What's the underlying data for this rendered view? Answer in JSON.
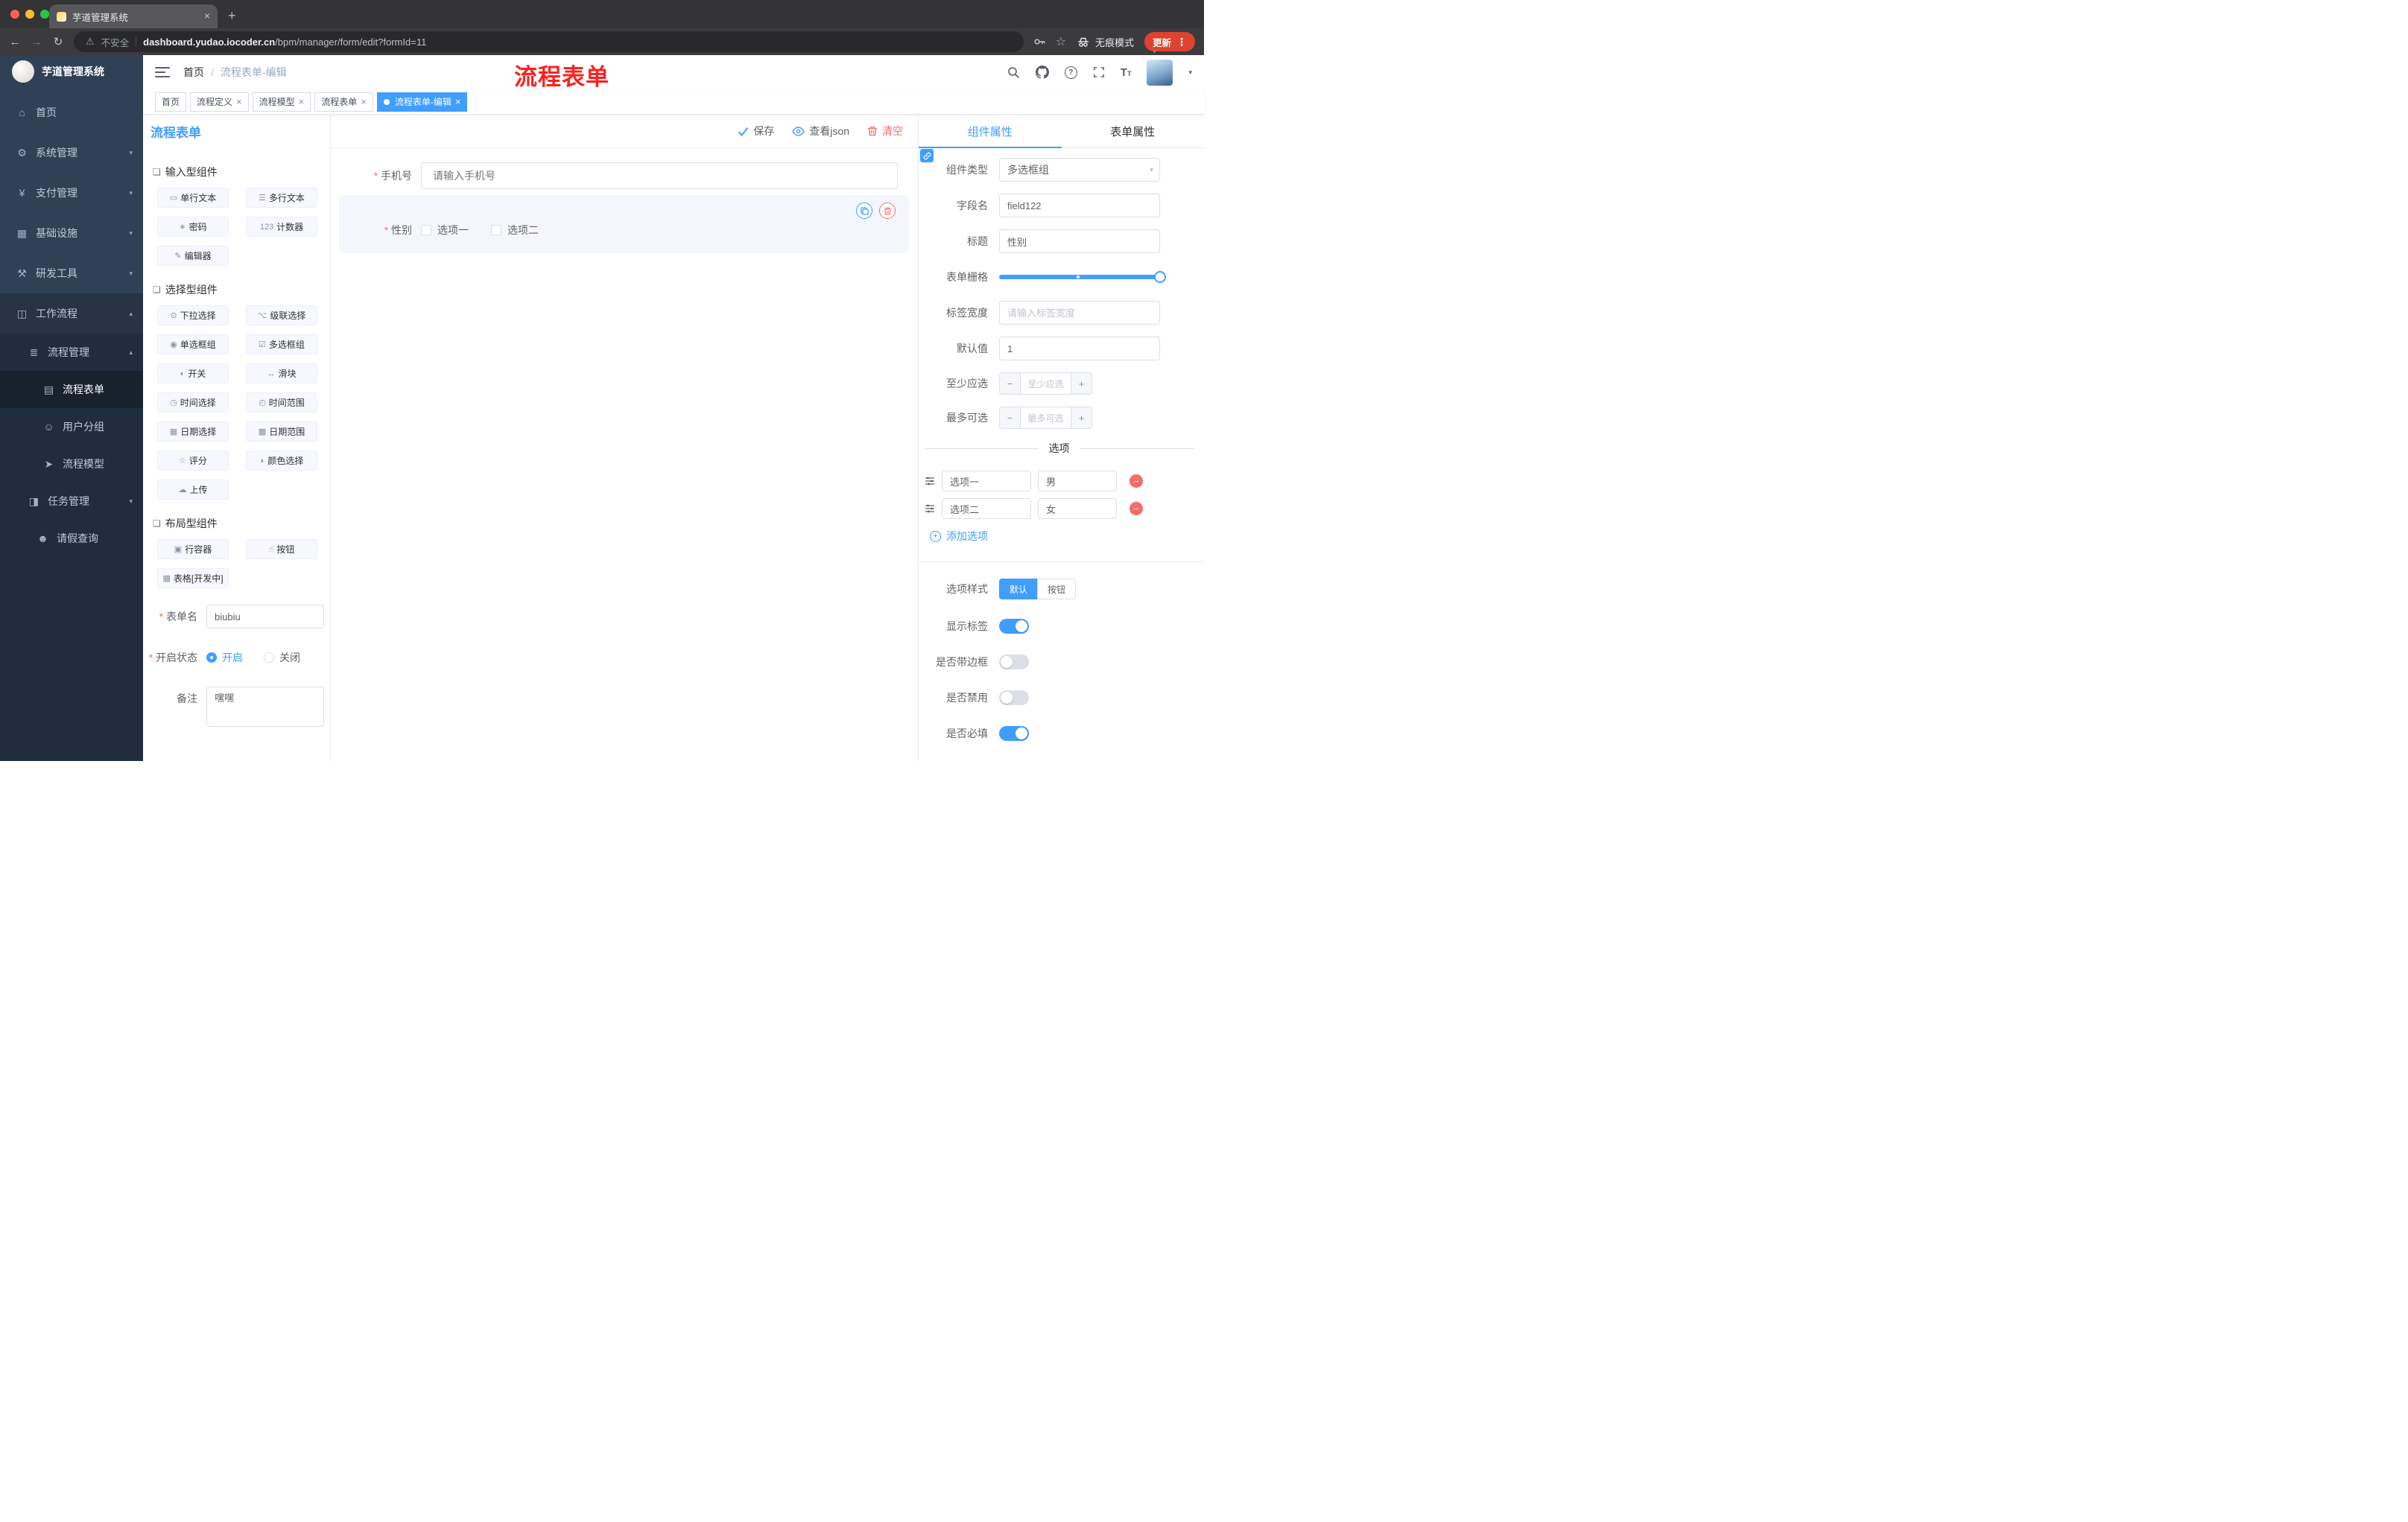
{
  "browser": {
    "tab_title": "芋道管理系统",
    "security_label": "不安全",
    "url_domain": "dashboard.yudao.iocoder.cn",
    "url_path": "/bpm/manager/form/edit?formId=11",
    "incognito_label": "无痕模式",
    "update_label": "更新"
  },
  "sidebar": {
    "logo_title": "芋道管理系统",
    "items": [
      {
        "label": "首页",
        "icon": "⌂"
      },
      {
        "label": "系统管理",
        "icon": "⚙"
      },
      {
        "label": "支付管理",
        "icon": "¥"
      },
      {
        "label": "基础设施",
        "icon": "▦"
      },
      {
        "label": "研发工具",
        "icon": "⚒"
      },
      {
        "label": "工作流程",
        "icon": "◫"
      },
      {
        "label": "流程管理",
        "icon": "≣"
      },
      {
        "label": "流程表单",
        "icon": "▤"
      },
      {
        "label": "用户分组",
        "icon": "☺"
      },
      {
        "label": "流程模型",
        "icon": "➤"
      },
      {
        "label": "任务管理",
        "icon": "◨"
      },
      {
        "label": "请假查询",
        "icon": "☻"
      }
    ]
  },
  "header": {
    "breadcrumb_home": "首页",
    "breadcrumb_sep": "/",
    "breadcrumb_current": "流程表单-编辑",
    "annotation": "流程表单"
  },
  "tags": [
    {
      "label": "首页"
    },
    {
      "label": "流程定义"
    },
    {
      "label": "流程模型"
    },
    {
      "label": "流程表单"
    },
    {
      "label": "流程表单-编辑"
    }
  ],
  "designer": {
    "panel_title": "流程表单",
    "save_label": "保存",
    "view_json_label": "查看json",
    "clear_label": "清空",
    "groups": [
      {
        "title": "输入型组件",
        "icon": "❏",
        "items": [
          {
            "label": "单行文本",
            "icon": "▭"
          },
          {
            "label": "多行文本",
            "icon": "☰"
          },
          {
            "label": "密码",
            "icon": "∗"
          },
          {
            "label": "计数器",
            "icon": "123"
          },
          {
            "label": "编辑器",
            "icon": "✎"
          }
        ]
      },
      {
        "title": "选择型组件",
        "icon": "❏",
        "items": [
          {
            "label": "下拉选择",
            "icon": "⊙"
          },
          {
            "label": "级联选择",
            "icon": "⌥"
          },
          {
            "label": "单选框组",
            "icon": "◉"
          },
          {
            "label": "多选框组",
            "icon": "☑"
          },
          {
            "label": "开关",
            "icon": "◐"
          },
          {
            "label": "滑块",
            "icon": "↔"
          },
          {
            "label": "时间选择",
            "icon": "◷"
          },
          {
            "label": "时间范围",
            "icon": "◴"
          },
          {
            "label": "日期选择",
            "icon": "▦"
          },
          {
            "label": "日期范围",
            "icon": "▩"
          },
          {
            "label": "评分",
            "icon": "☆"
          },
          {
            "label": "颜色选择",
            "icon": "◗"
          },
          {
            "label": "上传",
            "icon": "☁"
          }
        ]
      },
      {
        "title": "布局型组件",
        "icon": "❏",
        "items": [
          {
            "label": "行容器",
            "icon": "▣"
          },
          {
            "label": "按钮",
            "icon": "☝"
          },
          {
            "label": "表格[开发中]",
            "icon": "▦"
          }
        ]
      }
    ],
    "meta": {
      "name_label": "表单名",
      "name_value": "biubiu",
      "status_label": "开启状态",
      "status_on": "开启",
      "status_off": "关闭",
      "remark_label": "备注",
      "remark_value": "嘿嘿"
    },
    "canvas": {
      "phone_label": "手机号",
      "phone_placeholder": "请输入手机号",
      "gender_label": "性别",
      "gender_option1": "选项一",
      "gender_option2": "选项二"
    }
  },
  "props": {
    "tab_component": "组件属性",
    "tab_form": "表单属性",
    "component_type_label": "组件类型",
    "component_type_value": "多选框组",
    "field_name_label": "字段名",
    "field_name_value": "field122",
    "title_label": "标题",
    "title_value": "性别",
    "grid_label": "表单栅格",
    "label_width_label": "标签宽度",
    "label_width_placeholder": "请输入标签宽度",
    "default_label": "默认值",
    "default_value": "1",
    "min_label": "至少应选",
    "min_placeholder": "至少应选",
    "max_label": "最多可选",
    "max_placeholder": "最多可选",
    "options_divider": "选项",
    "options": [
      {
        "label": "选项一",
        "value": "男"
      },
      {
        "label": "选项二",
        "value": "女"
      }
    ],
    "add_option_label": "添加选项",
    "option_style_label": "选项样式",
    "style_default": "默认",
    "style_button": "按钮",
    "show_label_label": "显示标签",
    "border_label": "是否带边框",
    "disabled_label": "是否禁用",
    "required_label": "是否必填"
  },
  "colors": {
    "accent": "#409eff",
    "danger": "#f56c6c",
    "annotation_red": "#ff1f1f",
    "update_pill": "#dd4330",
    "sidebar_bg": "#304156",
    "submenu_bg": "#1f2d3d"
  }
}
